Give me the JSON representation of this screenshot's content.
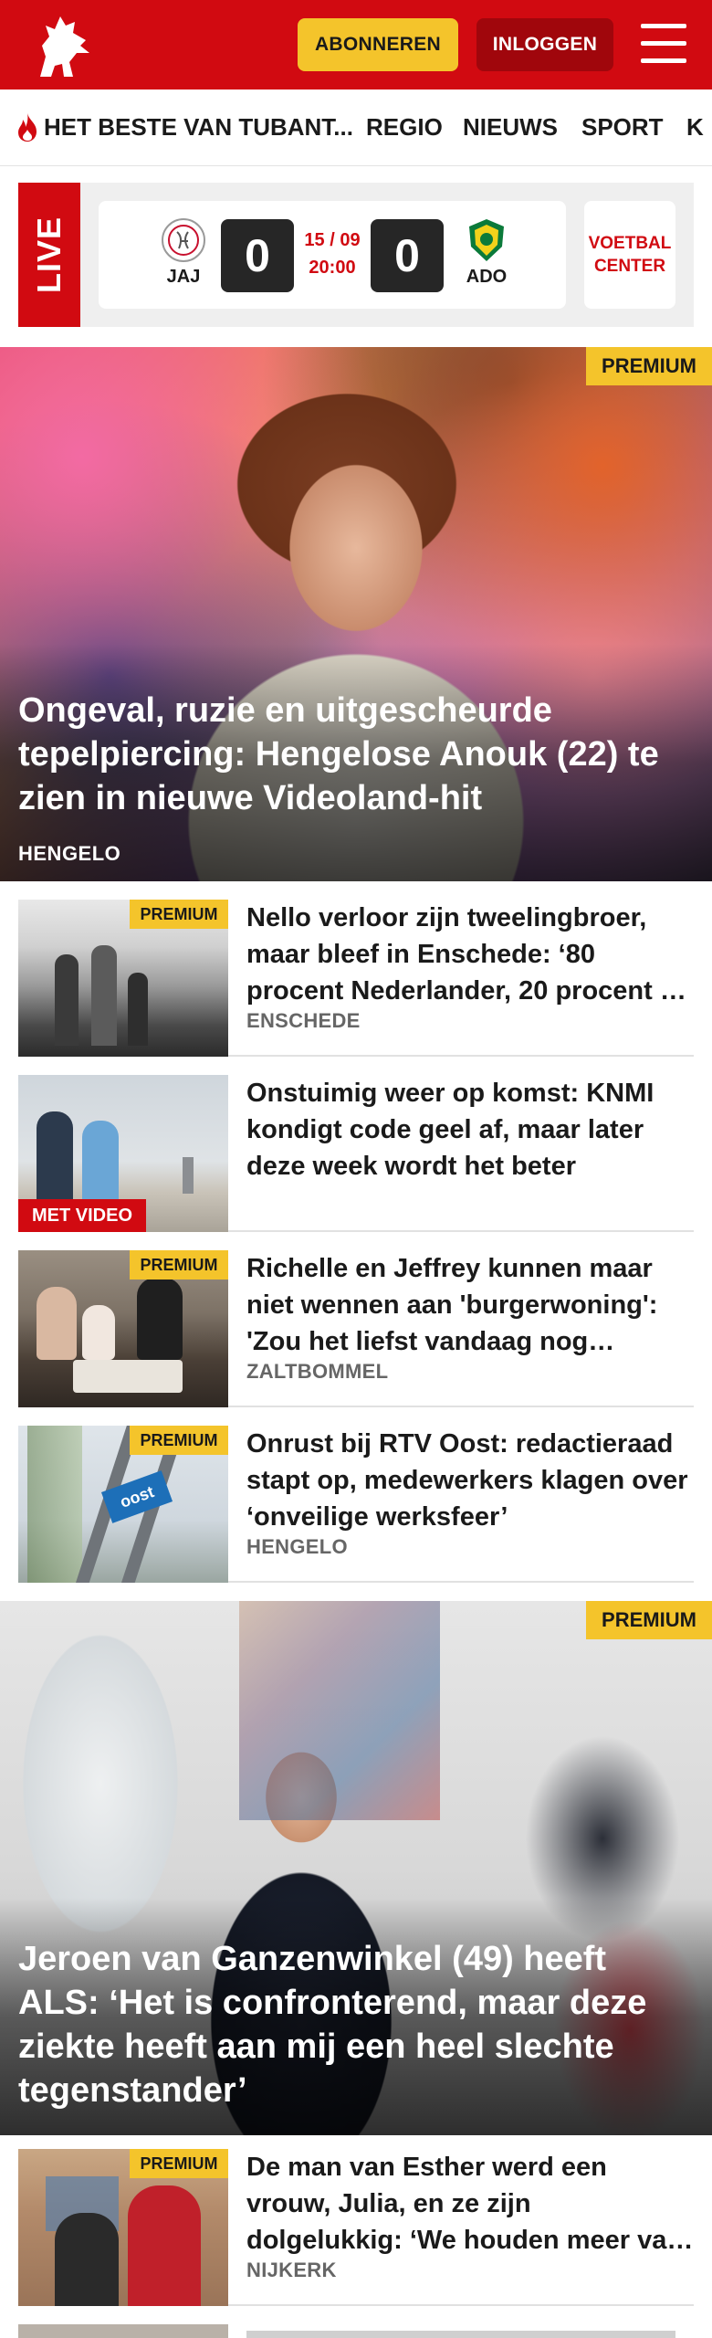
{
  "header": {
    "subscribe_label": "ABONNEREN",
    "login_label": "INLOGGEN",
    "brand_color": "#d10a11",
    "icons": [
      "tubantia-horse-logo-icon",
      "menu-icon"
    ]
  },
  "nav": {
    "items": [
      "HET BESTE VAN TUBANT...",
      "REGIO",
      "NIEUWS",
      "SPORT",
      "K"
    ]
  },
  "live": {
    "label": "LIVE",
    "home_team": "JAJ",
    "away_team": "ADO",
    "home_score": "0",
    "away_score": "0",
    "date": "15 / 09",
    "time": "20:00",
    "voetbal_center": [
      "VOETBAL",
      "CENTER"
    ]
  },
  "articles": [
    {
      "kind": "hero",
      "premium": "PREMIUM",
      "title": "Ongeval, ruzie en uitgescheurde tepelpiercing: Hengelose Anouk (22) te zien in nieuwe Videoland-hit",
      "place": "HENGELO"
    },
    {
      "kind": "list",
      "premium": "PREMIUM",
      "title": "Nello verloor zijn tweelingbroer, maar bleef in Enschede: ‘80 procent Nederlander, 20 procent …",
      "place": "ENSCHEDE"
    },
    {
      "kind": "list",
      "video": "MET VIDEO",
      "title": "Onstuimig weer op komst: KNMI kondigt code geel af, maar later deze week wordt het beter",
      "place": ""
    },
    {
      "kind": "list",
      "premium": "PREMIUM",
      "title": "Richelle en Jeffrey kunnen maar niet wennen aan 'burgerwoning': 'Zou het liefst vandaag nog…",
      "place": "ZALTBOMMEL"
    },
    {
      "kind": "list",
      "premium": "PREMIUM",
      "title": "Onrust bij RTV Oost: redactieraad stapt op, medewerkers klagen over ‘onveilige werksfeer’",
      "place": "HENGELO"
    },
    {
      "kind": "hero",
      "premium": "PREMIUM",
      "title": "Jeroen van Ganzenwinkel (49) heeft ALS: ‘Het is confronterend, maar deze ziekte heeft aan mij een heel slechte tegenstander’",
      "place": ""
    },
    {
      "kind": "list",
      "premium": "PREMIUM",
      "title": "De man van Esther werd een vrouw, Julia, en ze zijn dolgelukkig: ‘We houden meer van elkaa…",
      "place": "NIJKERK"
    }
  ]
}
